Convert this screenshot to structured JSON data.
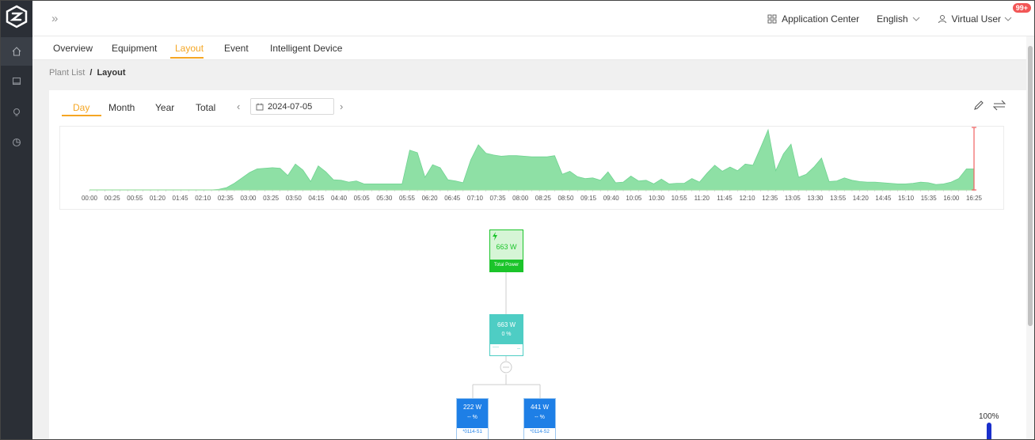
{
  "header": {
    "application_center": "Application Center",
    "language": "English",
    "user": "Virtual User",
    "notification_badge": "99+"
  },
  "tabs": [
    {
      "label": "Overview"
    },
    {
      "label": "Equipment"
    },
    {
      "label": "Layout",
      "active": true
    },
    {
      "label": "Event"
    },
    {
      "label": "Intelligent Device"
    }
  ],
  "breadcrumb": {
    "parent": "Plant List",
    "separator": "/",
    "current": "Layout"
  },
  "period_tabs": [
    {
      "label": "Day",
      "active": true
    },
    {
      "label": "Month"
    },
    {
      "label": "Year"
    },
    {
      "label": "Total"
    }
  ],
  "date": "2024-07-05",
  "chart_data": {
    "type": "area",
    "x_ticks": [
      "00:00",
      "00:25",
      "00:55",
      "01:20",
      "01:45",
      "02:10",
      "02:35",
      "03:00",
      "03:25",
      "03:50",
      "04:15",
      "04:40",
      "05:05",
      "05:30",
      "05:55",
      "06:20",
      "06:45",
      "07:10",
      "07:35",
      "08:00",
      "08:25",
      "08:50",
      "09:15",
      "09:40",
      "10:05",
      "10:30",
      "10:55",
      "11:20",
      "11:45",
      "12:10",
      "12:35",
      "13:05",
      "13:30",
      "13:55",
      "14:20",
      "14:45",
      "15:10",
      "15:35",
      "16:00",
      "16:25"
    ],
    "values": [
      0,
      0,
      0,
      0,
      0,
      0,
      0,
      0,
      0,
      0,
      0,
      0,
      0,
      0,
      0,
      0,
      0,
      1,
      4,
      11,
      20,
      29,
      35,
      36,
      37,
      36,
      24,
      43,
      33,
      14,
      40,
      30,
      17,
      16,
      13,
      15,
      10,
      10,
      10,
      10,
      10,
      10,
      66,
      62,
      21,
      42,
      37,
      17,
      15,
      12,
      50,
      75,
      61,
      58,
      56,
      57,
      57,
      56,
      55,
      55,
      55,
      57,
      26,
      31,
      22,
      19,
      20,
      16,
      30,
      12,
      13,
      23,
      15,
      16,
      10,
      18,
      10,
      11,
      11,
      19,
      13,
      28,
      41,
      31,
      38,
      32,
      43,
      41,
      70,
      100,
      32,
      60,
      76,
      21,
      26,
      38,
      53,
      14,
      15,
      20,
      16,
      14,
      13,
      13,
      12,
      11,
      10,
      10,
      11,
      13,
      12,
      9,
      10,
      13,
      19,
      35,
      35
    ],
    "color": "#8ee0a5",
    "cursor_color": "#f06060",
    "grid": false
  },
  "topology": {
    "root": {
      "value": "663 W",
      "label": "Total Power",
      "color": "#1bc42a"
    },
    "inverter": {
      "value": "663 W",
      "percent": "0 %",
      "footer_left": "----",
      "footer_right": "--",
      "color": "#4ecdc4"
    },
    "strings": [
      {
        "value": "222 W",
        "percent": "-- %",
        "id": "*0114-S1",
        "color": "#1e7fe6"
      },
      {
        "value": "441 W",
        "percent": "-- %",
        "id": "*0114-S2",
        "color": "#1e7fe6"
      }
    ],
    "scale_label": "100%"
  }
}
